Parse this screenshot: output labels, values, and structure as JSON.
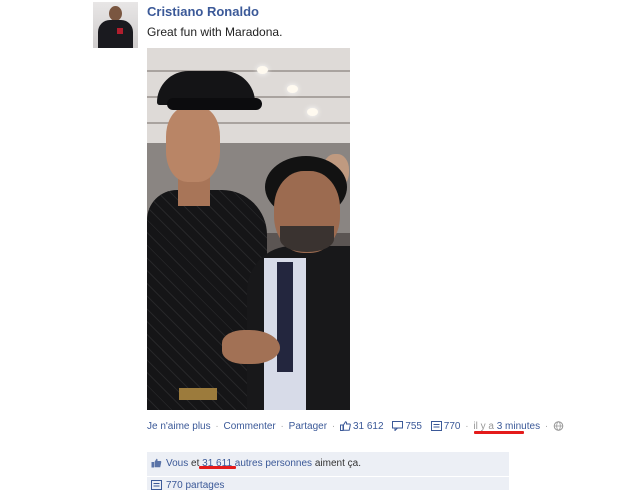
{
  "post": {
    "author": "Cristiano Ronaldo",
    "caption": "Great fun with Maradona."
  },
  "actions": {
    "unlike": "Je n'aime plus",
    "comment": "Commenter",
    "share": "Partager",
    "like_count": "31 612",
    "comment_count": "755",
    "share_count": "770",
    "time_prefix": "il y a",
    "time_value": "3 minutes",
    "separator": "·"
  },
  "likes": {
    "you": "Vous",
    "and": "et",
    "others_count": "31 611",
    "others_label": "autres personnes",
    "suffix": "aiment ça."
  },
  "shares": {
    "label": "770 partages"
  },
  "colors": {
    "link": "#3b5998",
    "highlight_underline": "#e41b1b",
    "box_background": "#eceff5"
  },
  "icons": {
    "like": "thumbs-up-icon",
    "comment": "comment-bubble-icon",
    "share": "share-icon",
    "privacy": "globe-icon"
  }
}
